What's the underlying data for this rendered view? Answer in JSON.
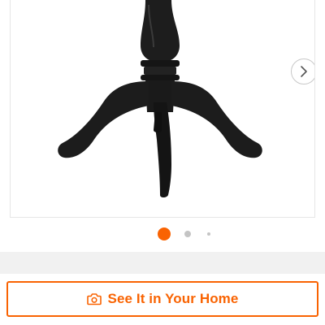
{
  "gallery": {
    "image_name": "pedestal-table-base",
    "image_color": "#1f1f1f",
    "next_icon": "chevron-right-icon",
    "pagination": {
      "total": 3,
      "active_index": 0,
      "active_color": "#f96302",
      "inactive_color": "#c4c4c4"
    }
  },
  "cta": {
    "label": "See It in Your Home",
    "icon": "camera-icon",
    "accent_color": "#f96302"
  }
}
